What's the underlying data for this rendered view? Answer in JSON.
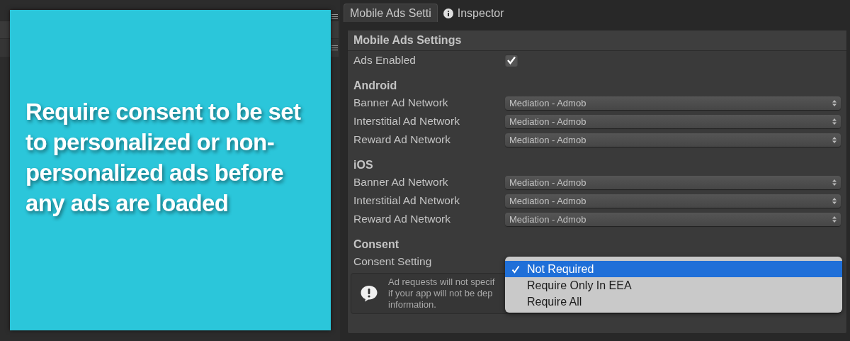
{
  "caption": "Require consent to be set to personalized or non-personalized ads before any ads are loaded",
  "tabs": [
    {
      "label": "Mobile Ads Setti",
      "selected": true,
      "kind": "plain"
    },
    {
      "label": "Inspector",
      "selected": false,
      "kind": "info"
    }
  ],
  "panel": {
    "title": "Mobile Ads Settings",
    "ads_enabled": {
      "label": "Ads Enabled",
      "checked": true
    }
  },
  "sections": [
    {
      "title": "Android",
      "rows": [
        {
          "label": "Banner Ad Network",
          "value": "Mediation - Admob"
        },
        {
          "label": "Interstitial Ad Network",
          "value": "Mediation - Admob"
        },
        {
          "label": "Reward Ad Network",
          "value": "Mediation - Admob"
        }
      ]
    },
    {
      "title": "iOS",
      "rows": [
        {
          "label": "Banner Ad Network",
          "value": "Mediation - Admob"
        },
        {
          "label": "Interstitial Ad Network",
          "value": "Mediation - Admob"
        },
        {
          "label": "Reward Ad Network",
          "value": "Mediation - Admob"
        }
      ]
    }
  ],
  "consent": {
    "title": "Consent",
    "label": "Consent Setting",
    "options": [
      {
        "label": "Not Required",
        "selected": true
      },
      {
        "label": "Require Only In EEA",
        "selected": false
      },
      {
        "label": "Require All",
        "selected": false
      }
    ],
    "help_lines": [
      "Ad requests will not specif",
      "if your app will not be dep",
      "information."
    ]
  }
}
